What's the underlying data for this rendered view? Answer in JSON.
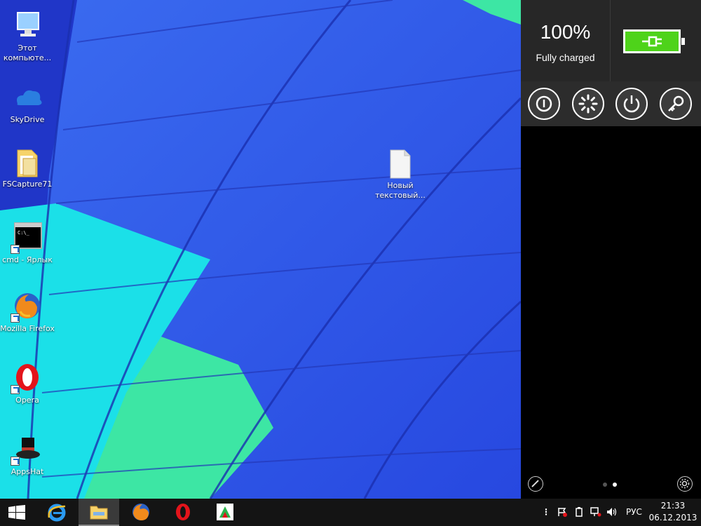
{
  "desktop": {
    "icons": [
      {
        "name": "this-pc",
        "label": "Этот компьюте..."
      },
      {
        "name": "skydrive",
        "label": "SkyDrive"
      },
      {
        "name": "fscapture",
        "label": "FSCapture71"
      },
      {
        "name": "cmd",
        "label": "cmd - Ярлык"
      },
      {
        "name": "firefox",
        "label": "Mozilla Firefox"
      },
      {
        "name": "opera",
        "label": "Opera"
      },
      {
        "name": "appshat",
        "label": "AppsHat"
      },
      {
        "name": "text-file",
        "label": "Новый текстовый..."
      }
    ]
  },
  "panel": {
    "battery_percent": "100%",
    "battery_status": "Fully charged",
    "battery_level": 1.0,
    "battery_color": "#4ed31a",
    "controls": [
      {
        "name": "sleep",
        "icon": "sleep-icon"
      },
      {
        "name": "restart",
        "icon": "loading-icon"
      },
      {
        "name": "power",
        "icon": "power-icon"
      },
      {
        "name": "lock",
        "icon": "key-icon"
      }
    ],
    "page_count": 2,
    "active_page": 2
  },
  "taskbar": {
    "apps": [
      "start",
      "internet-explorer",
      "file-explorer",
      "firefox",
      "opera",
      "appshat"
    ],
    "active_app": "file-explorer",
    "language": "РУС",
    "time": "21:33",
    "date": "06.12.2013"
  },
  "colors": {
    "wallpaper_blue": "#2a4de8",
    "wallpaper_cyan": "#19e6e6",
    "wallpaper_green": "#2ee6a0",
    "panel_bg": "#272727",
    "taskbar_bg": "#141414"
  }
}
